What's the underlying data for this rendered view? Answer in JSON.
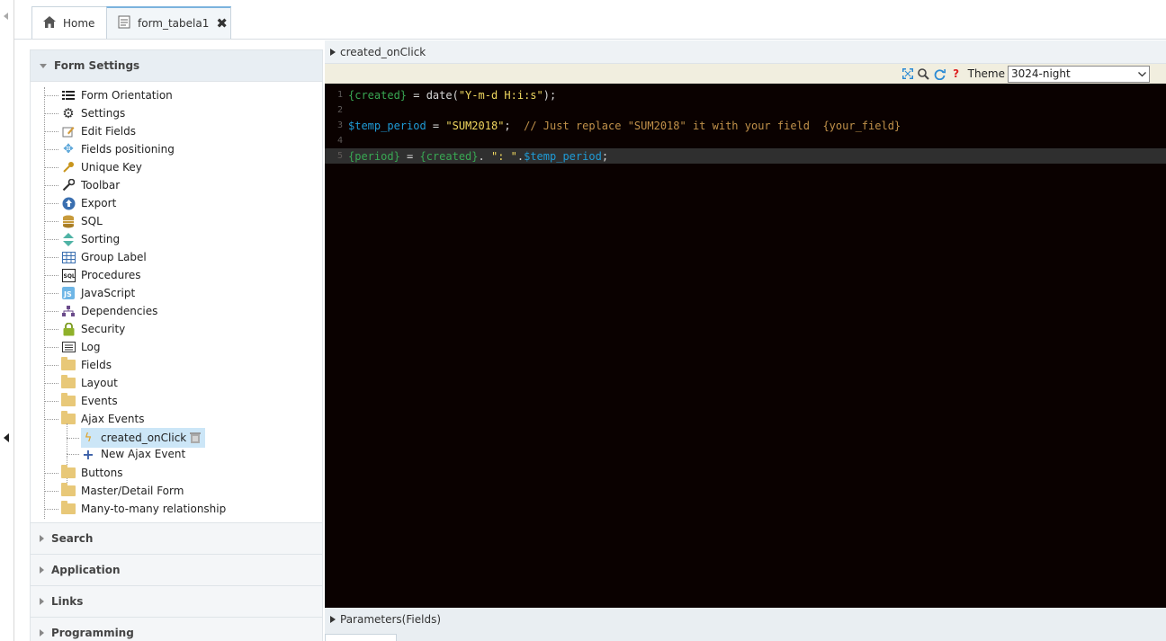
{
  "tabs": [
    {
      "label": "Home",
      "icon": "home-icon"
    },
    {
      "label": "form_tabela1",
      "icon": "document-icon",
      "closable": true
    }
  ],
  "left": {
    "form_settings_title": "Form Settings",
    "tree": [
      {
        "label": "Form Orientation",
        "icon": "list-icon"
      },
      {
        "label": "Settings",
        "icon": "gear-icon"
      },
      {
        "label": "Edit Fields",
        "icon": "edit-icon"
      },
      {
        "label": "Fields positioning",
        "icon": "move-icon"
      },
      {
        "label": "Unique Key",
        "icon": "key-icon"
      },
      {
        "label": "Toolbar",
        "icon": "wrench-icon"
      },
      {
        "label": "Export",
        "icon": "export-icon"
      },
      {
        "label": "SQL",
        "icon": "database-icon"
      },
      {
        "label": "Sorting",
        "icon": "sort-icon"
      },
      {
        "label": "Group Label",
        "icon": "table-icon"
      },
      {
        "label": "Procedures",
        "icon": "sql-icon"
      },
      {
        "label": "JavaScript",
        "icon": "js-icon"
      },
      {
        "label": "Dependencies",
        "icon": "hierarchy-icon"
      },
      {
        "label": "Security",
        "icon": "lock-icon"
      },
      {
        "label": "Log",
        "icon": "log-icon"
      },
      {
        "label": "Fields",
        "icon": "folder-icon"
      },
      {
        "label": "Layout",
        "icon": "folder-icon"
      },
      {
        "label": "Events",
        "icon": "folder-icon"
      },
      {
        "label": "Ajax Events",
        "icon": "folder-icon"
      },
      {
        "label": "created_onClick",
        "icon": "lightning-icon"
      },
      {
        "label": "New Ajax Event",
        "icon": "plus-icon"
      },
      {
        "label": "Buttons",
        "icon": "folder-icon"
      },
      {
        "label": "Master/Detail Form",
        "icon": "folder-icon"
      },
      {
        "label": "Many-to-many relationship",
        "icon": "folder-icon"
      }
    ],
    "collapsed_sections": [
      "Search",
      "Application",
      "Links",
      "Programming"
    ]
  },
  "editor": {
    "title": "created_onClick",
    "theme_label": "Theme",
    "theme_value": "3024-night",
    "line_numbers": [
      "1",
      "2",
      "3",
      "4",
      "5"
    ],
    "params_label": "Parameters(Fields)",
    "code": {
      "l1": {
        "a": "{created}",
        "b": " = date(",
        "c": "\"Y-m-d H:i:s\"",
        "d": ");"
      },
      "l3": {
        "a": "$temp_period",
        "b": " = ",
        "c": "\"SUM2018\"",
        "d": ";  ",
        "e": "// Just replace \"SUM2018\" it with your field  {your_field}"
      },
      "l5": {
        "a": "{period}",
        "b": " = ",
        "c": "{created}",
        "d": ". ",
        "e": "\": \"",
        "f": ".",
        "g": "$temp_period",
        "h": ";"
      }
    }
  },
  "colors": {
    "editor_bg": "#0a0100",
    "green": "#39a853",
    "yellow": "#f0d860",
    "blue": "#1f9bd6",
    "comment": "#c0914a"
  }
}
